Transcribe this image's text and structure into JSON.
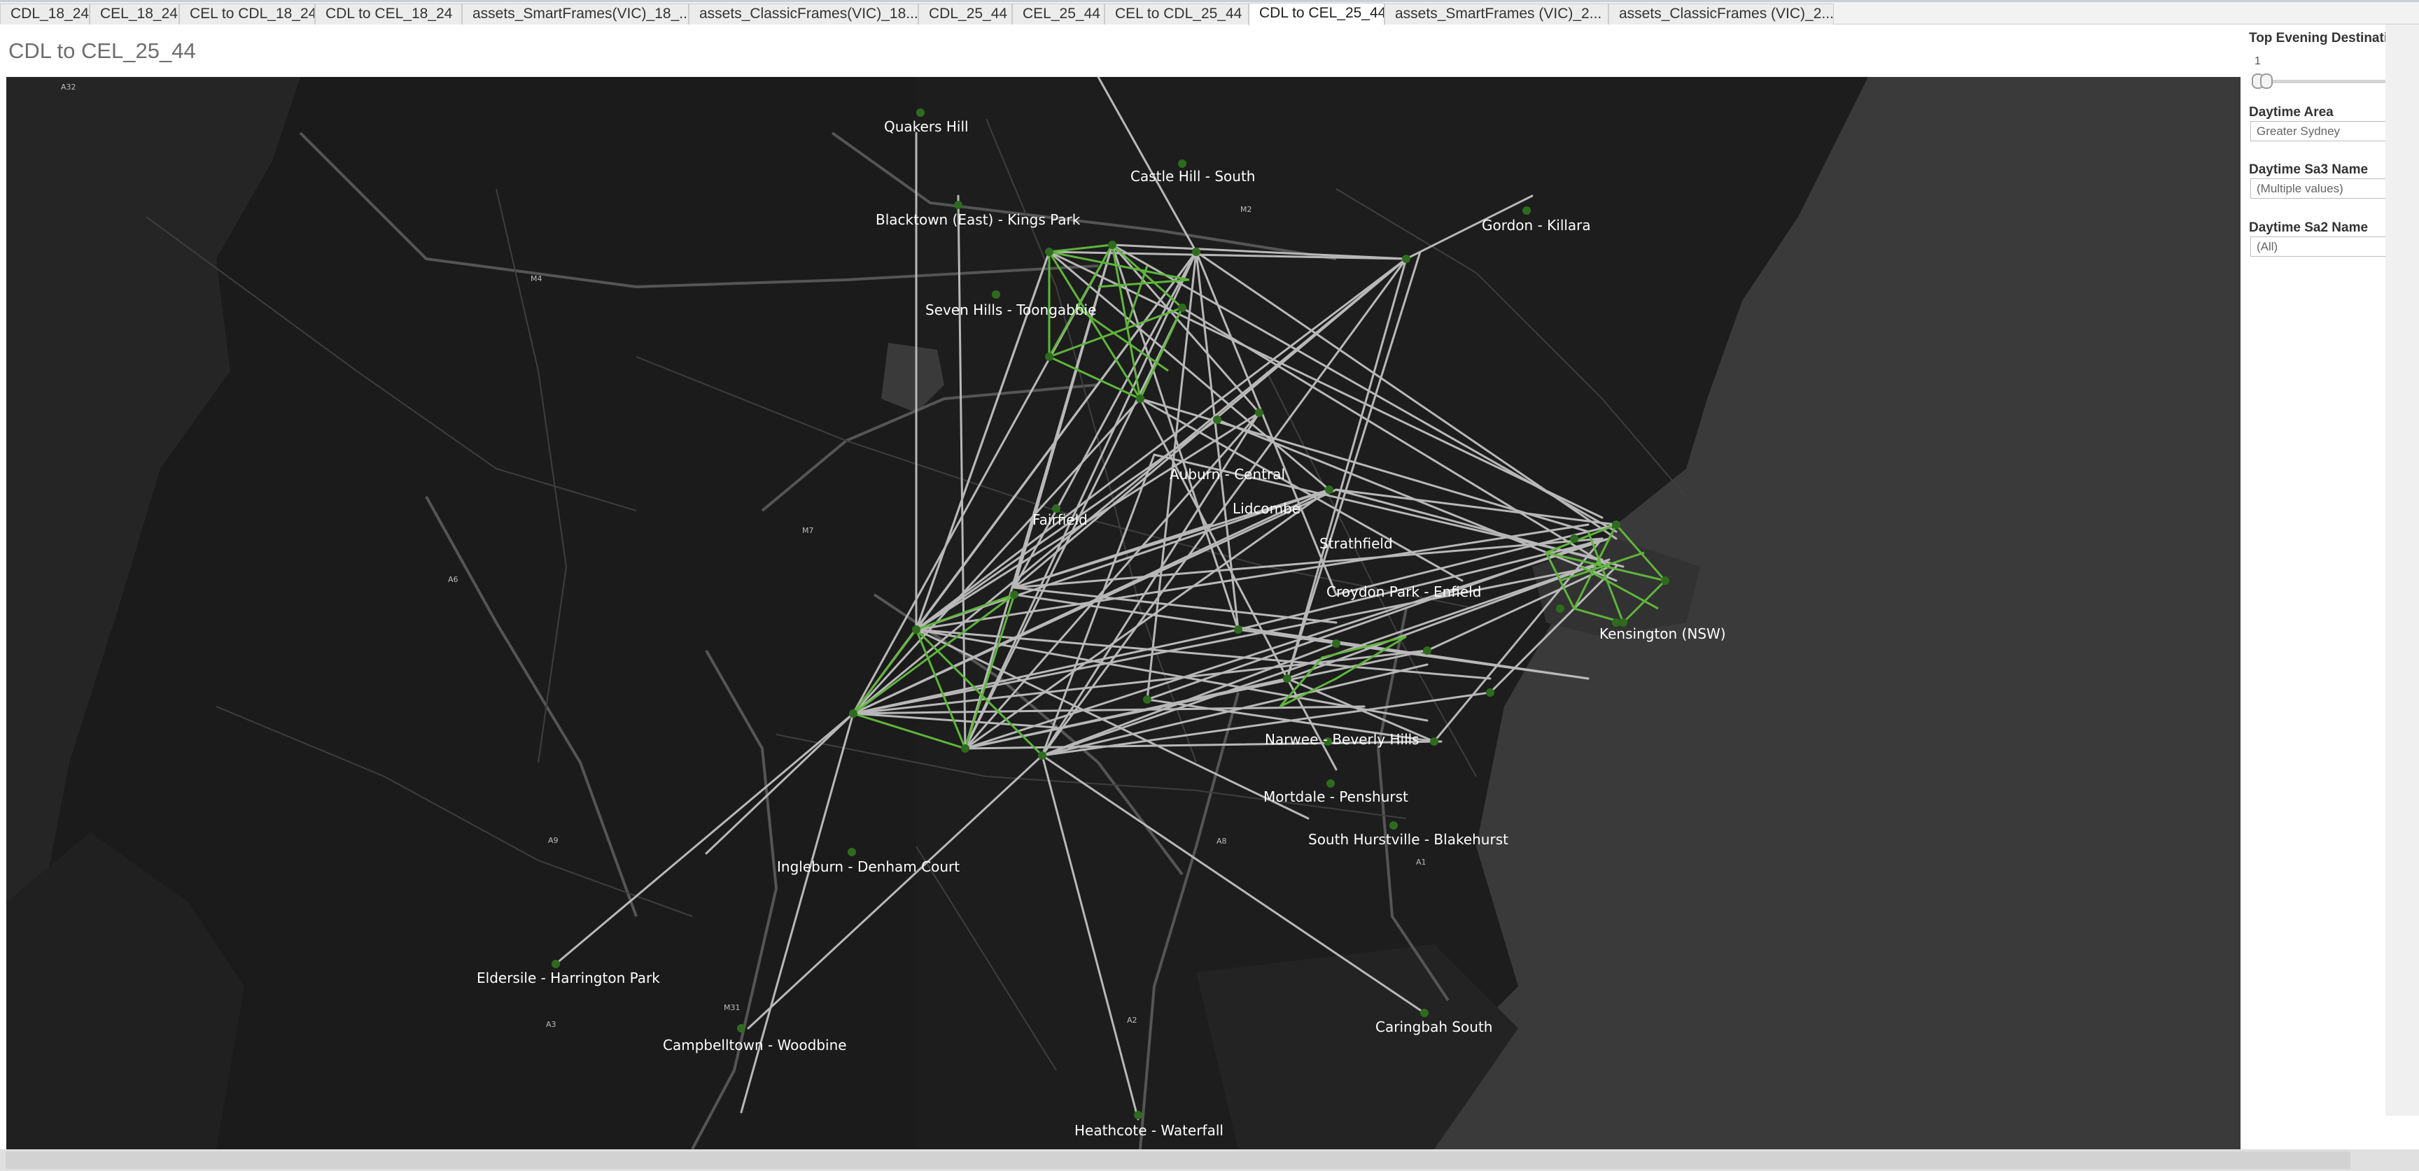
{
  "tabs": [
    {
      "label": "CDL_18_24",
      "active": false
    },
    {
      "label": "CEL_18_24",
      "active": false
    },
    {
      "label": "CEL to CDL_18_24",
      "active": false
    },
    {
      "label": "CDL to CEL_18_24",
      "active": false
    },
    {
      "label": "assets_SmartFrames(VIC)_18_...",
      "active": false
    },
    {
      "label": "assets_ClassicFrames(VIC)_18...",
      "active": false
    },
    {
      "label": "CDL_25_44",
      "active": false
    },
    {
      "label": "CEL_25_44",
      "active": false
    },
    {
      "label": "CEL to CDL_25_44",
      "active": false
    },
    {
      "label": "CDL to CEL_25_44",
      "active": true
    },
    {
      "label": "assets_SmartFrames  (VIC)_2...",
      "active": false
    },
    {
      "label": "assets_ClassicFrames  (VIC)_2...",
      "active": false
    }
  ],
  "view_title": "CDL to CEL_25_44",
  "filters": {
    "top_evening_label": "Top Evening Destinatio",
    "top_evening_value": "1",
    "daytime_area_label": "Daytime Area",
    "daytime_area_value": "Greater Sydney",
    "daytime_sa3_label": "Daytime Sa3 Name",
    "daytime_sa3_value": "(Multiple values)",
    "daytime_sa2_label": "Daytime Sa2 Name",
    "daytime_sa2_value": "(All)"
  },
  "map": {
    "colors": {
      "background": "#1b1b1b",
      "land_light": "#2a2a2a",
      "water": "#3a3a3a",
      "road": "#5a5a5a",
      "flow_line": "#b8b8b8",
      "cluster_line": "#5fb53c",
      "node": "#2e6b1f"
    },
    "place_labels": [
      "Quakers Hill",
      "Castle Hill - South",
      "Blacktown (East) - Kings Park",
      "Gordon - Killara",
      "Seven Hills - Toongabbie",
      "Auburn - Central",
      "Lidcombe",
      "Fairfield",
      "Strathfield",
      "Croydon Park - Enfield",
      "Kensington (NSW)",
      "Narwee - Beverly Hills",
      "Mortdale - Penshurst",
      "South Hurstville - Blakehurst",
      "Ingleburn - Denham Court",
      "Eldersile - Harrington Park",
      "Campbelltown - Woodbine",
      "Caringbah South",
      "Heathcote - Waterfall"
    ],
    "road_labels": [
      "A32",
      "M2",
      "M4",
      "M7",
      "A6",
      "A9",
      "M31",
      "A1",
      "A8",
      "A2",
      "A3"
    ]
  }
}
